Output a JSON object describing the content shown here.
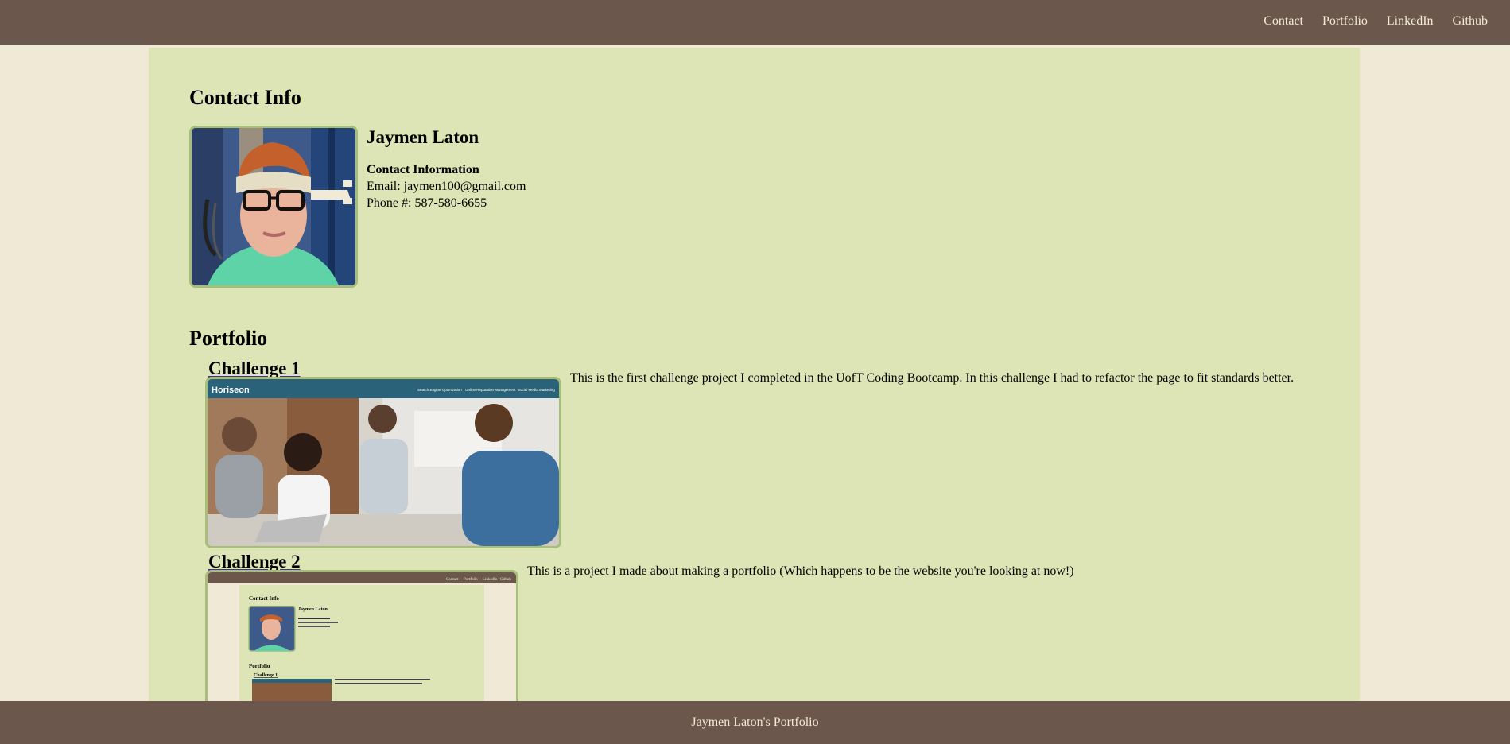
{
  "nav": {
    "items": [
      {
        "label": "Contact"
      },
      {
        "label": "Portfolio"
      },
      {
        "label": "LinkedIn"
      },
      {
        "label": "Github"
      }
    ]
  },
  "contact": {
    "heading": "Contact Info",
    "name": "Jaymen Laton",
    "info_label": "Contact Information",
    "email": "Email: jaymen100@gmail.com",
    "phone": "Phone #: 587-580-6655"
  },
  "portfolio": {
    "heading": "Portfolio",
    "projects": [
      {
        "title": "Challenge 1",
        "description": "This is the first challenge project I completed in the UofT Coding Bootcamp. In this challenge I had to refactor the page to fit standards better.",
        "thumb_brand": "Horiseon",
        "thumb_nav": [
          "Search Engine Optimization",
          "Online Reputation Management",
          "Social Media Marketing"
        ]
      },
      {
        "title": "Challenge 2",
        "description": "This is a project I made about making a portfolio (Which happens to be the website you're looking at now!)",
        "thumb_nav": [
          "Contact",
          "Portfolio",
          "LinkedIn",
          "Github"
        ]
      }
    ]
  },
  "footer": {
    "text": "Jaymen Laton's Portfolio"
  },
  "colors": {
    "header_bg": "#6b574c",
    "page_bg": "#f0e9d6",
    "main_bg": "#dde5b6",
    "image_border": "#a7bd78"
  }
}
